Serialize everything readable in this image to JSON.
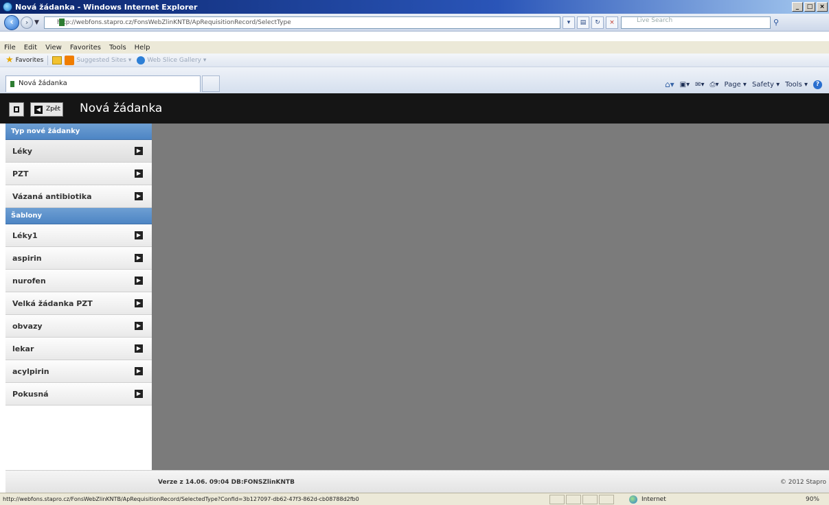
{
  "window": {
    "title": "Nová žádanka - Windows Internet Explorer",
    "controls": [
      "_",
      "□",
      "×"
    ]
  },
  "address_bar": {
    "url": "http://webfons.stapro.cz/FonsWebZlinKNTB/ApRequisitionRecord/SelectType",
    "search_placeholder": "Live Search"
  },
  "menu": [
    "File",
    "Edit",
    "View",
    "Favorites",
    "Tools",
    "Help"
  ],
  "favorites_bar": {
    "favorites_label": "Favorites",
    "suggested_sites": "Suggested Sites ▾",
    "web_slice_gallery": "Web Slice Gallery ▾"
  },
  "tabs": {
    "active_tab": "Nová žádanka"
  },
  "command_bar": {
    "page": "Page ▾",
    "safety": "Safety ▾",
    "tools": "Tools ▾"
  },
  "app": {
    "back_label": "Zpět",
    "title": "Nová žádanka"
  },
  "sidebar": {
    "section1_header": "Typ nové žádanky",
    "section1_items": [
      {
        "label": "Léky"
      },
      {
        "label": "PZT"
      },
      {
        "label": "Vázaná antibiotika"
      }
    ],
    "section2_header": "Šablony",
    "section2_items": [
      {
        "label": "Léky1"
      },
      {
        "label": "aspirin"
      },
      {
        "label": "nurofen"
      },
      {
        "label": "Velká žádanka PZT"
      },
      {
        "label": "obvazy"
      },
      {
        "label": "lekar"
      },
      {
        "label": "acylpirin"
      },
      {
        "label": "Pokusná"
      }
    ]
  },
  "footer": {
    "version": "Verze z 14.06. 09:04 DB:FONSZlinKNTB",
    "copyright": "© 2012 Stapro"
  },
  "status_bar": {
    "url": "http://webfons.stapro.cz/FonsWebZlinKNTB/ApRequisitionRecord/SelectedType?ConfId=3b127097-db62-47f3-862d-cb08788d2fb0",
    "zone": "Internet",
    "zoom": "90%"
  }
}
